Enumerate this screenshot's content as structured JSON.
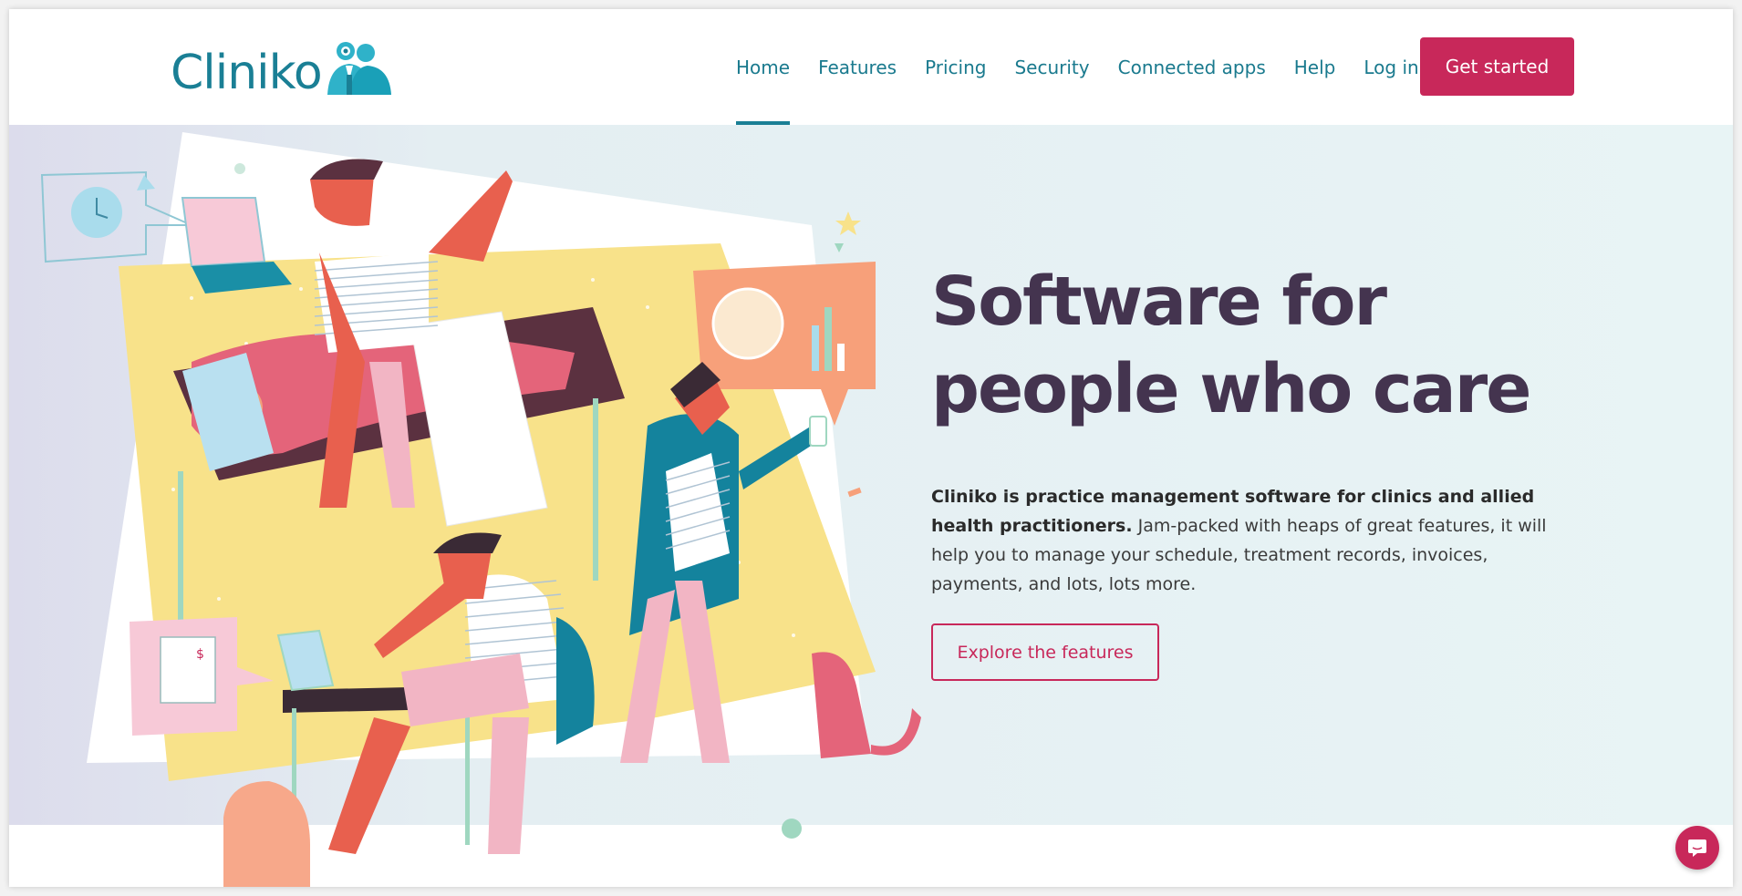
{
  "brand": {
    "name": "Cliniko",
    "accent": "#c8285a",
    "teal": "#1a7f95",
    "headline_color": "#44344f"
  },
  "nav": {
    "items": [
      "Home",
      "Features",
      "Pricing",
      "Security",
      "Connected apps",
      "Help",
      "Log in"
    ],
    "active": "Home",
    "cta": "Get started"
  },
  "hero": {
    "headline_line1": "Software for",
    "headline_line2": "people who care",
    "desc_bold": "Cliniko is practice management software for clinics and allied health practitioners.",
    "desc_rest": " Jam-packed with heaps of great features, it will help you to manage your schedule, treatment records, invoices, payments, and lots, lots more.",
    "explore_label": "Explore the features"
  },
  "icons": {
    "chat": "chat-bubble-icon",
    "logo_mark": "people-logo-icon"
  }
}
